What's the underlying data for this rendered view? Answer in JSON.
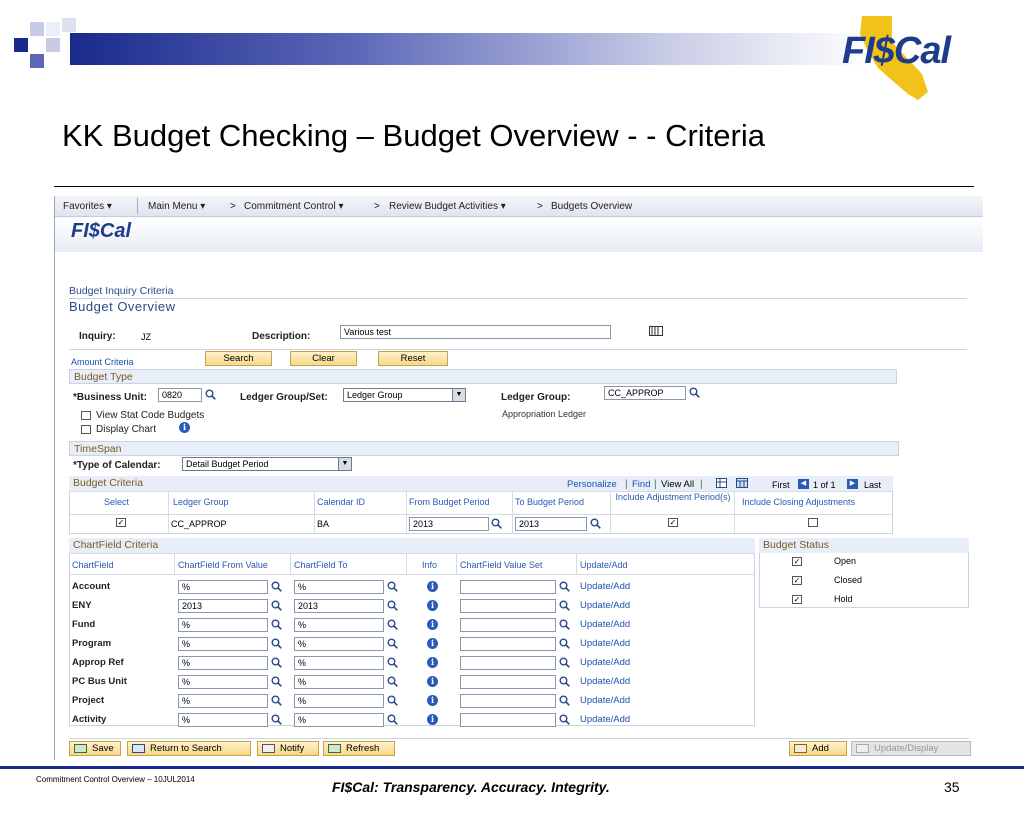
{
  "slide": {
    "title": "KK Budget Checking – Budget Overview - - Criteria",
    "logo_text": "FI$Cal",
    "footer_left": "Commitment Control Overview – 10JUL2014",
    "footer_center": "FI$Cal:  Transparency.  Accuracy.  Integrity.",
    "page_number": "35"
  },
  "nav": {
    "favorites": "Favorites",
    "main_menu": "Main Menu",
    "crumbs": [
      "Commitment Control",
      "Review Budget Activities",
      "Budgets Overview"
    ]
  },
  "app": {
    "logo_text": "FI$Cal",
    "inquiry_criteria_label": "Budget Inquiry Criteria",
    "page_title": "Budget Overview",
    "inquiry_label": "Inquiry:",
    "inquiry_value": "JZ",
    "description_label": "Description:",
    "description_value": "Various test",
    "amount_criteria_link": "Amount Criteria",
    "buttons": {
      "search": "Search",
      "clear": "Clear",
      "reset": "Reset"
    }
  },
  "budget_type": {
    "header": "Budget Type",
    "business_unit_label": "*Business Unit:",
    "business_unit_value": "0820",
    "ledger_group_set_label": "Ledger Group/Set:",
    "ledger_group_set_value": "Ledger Group",
    "ledger_group_label": "Ledger Group:",
    "ledger_group_value": "CC_APPROP",
    "ledger_group_desc": "Appropriation Ledger",
    "view_stat_label": "View Stat Code Budgets",
    "display_chart_label": "Display Chart"
  },
  "timespan": {
    "header": "TimeSpan",
    "calendar_label": "*Type of Calendar:",
    "calendar_value": "Detail Budget Period"
  },
  "budget_criteria": {
    "header": "Budget Criteria",
    "personalize": "Personalize",
    "find": "Find",
    "view_all": "View All",
    "first": "First",
    "range": "1 of 1",
    "last": "Last",
    "columns": [
      "Select",
      "Ledger Group",
      "Calendar ID",
      "From Budget Period",
      "To Budget Period",
      "Include Adjustment Period(s)",
      "Include Closing Adjustments"
    ],
    "row": {
      "select": "✓",
      "ledger_group": "CC_APPROP",
      "calendar_id": "BA",
      "from_period": "2013",
      "to_period": "2013",
      "include_adj": "✓",
      "include_closing": ""
    }
  },
  "chartfield": {
    "header": "ChartField Criteria",
    "columns": [
      "ChartField",
      "ChartField From Value",
      "ChartField To",
      "Info",
      "ChartField Value Set",
      "Update/Add"
    ],
    "rows": [
      {
        "name": "Account",
        "from": "%",
        "to": "%",
        "link": "Update/Add"
      },
      {
        "name": "ENY",
        "from": "2013",
        "to": "2013",
        "link": "Update/Add"
      },
      {
        "name": "Fund",
        "from": "%",
        "to": "%",
        "link": "Update/Add"
      },
      {
        "name": "Program",
        "from": "%",
        "to": "%",
        "link": "Update/Add"
      },
      {
        "name": "Approp Ref",
        "from": "%",
        "to": "%",
        "link": "Update/Add"
      },
      {
        "name": "PC Bus Unit",
        "from": "%",
        "to": "%",
        "link": "Update/Add"
      },
      {
        "name": "Project",
        "from": "%",
        "to": "%",
        "link": "Update/Add"
      },
      {
        "name": "Activity",
        "from": "%",
        "to": "%",
        "link": "Update/Add"
      }
    ]
  },
  "budget_status": {
    "header": "Budget Status",
    "items": [
      {
        "label": "Open",
        "checked": "✓"
      },
      {
        "label": "Closed",
        "checked": "✓"
      },
      {
        "label": "Hold",
        "checked": "✓"
      }
    ]
  },
  "toolbar": {
    "save": "Save",
    "return": "Return to Search",
    "notify": "Notify",
    "refresh": "Refresh",
    "add": "Add",
    "update_display": "Update/Display"
  }
}
